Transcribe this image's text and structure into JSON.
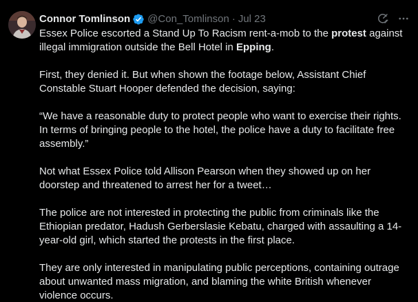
{
  "author": {
    "display_name": "Connor Tomlinson",
    "handle": "@Con_Tomlinson",
    "separator": "·",
    "date": "Jul 23",
    "verified": true
  },
  "icons": {
    "verified": "verified-badge-icon",
    "grok": "grok-icon",
    "more": "more-options-icon"
  },
  "colors": {
    "background": "#000000",
    "text": "#e7e9ea",
    "muted": "#71767b",
    "verified": "#1d9bf0"
  },
  "tweet": {
    "p1": {
      "a": "Essex Police escorted a Stand Up To Racism rent-a-mob to the ",
      "b": "protest",
      "c": " against illegal immigration outside the Bell Hotel in ",
      "d": "Epping",
      "e": "."
    },
    "p2": "First, they denied it. But when shown the footage below, Assistant Chief Constable Stuart Hooper defended the decision, saying:",
    "p3": "“We have a reasonable duty to protect people who want to exercise their rights. In terms of bringing people to the hotel, the police have a duty to facilitate free assembly.”",
    "p4": "Not what Essex Police told  Allison Pearson when they showed up on her doorstep and threatened to arrest her for a tweet…",
    "p5": "The police are not interested in protecting the public from criminals like the Ethiopian predator, Hadush Gerberslasie Kebatu, charged with assaulting a 14-year-old girl, which started the protests in the first place.",
    "p6": "They are only interested in manipulating public perceptions, containing outrage about unwanted mass migration, and blaming the white British whenever violence occurs."
  }
}
